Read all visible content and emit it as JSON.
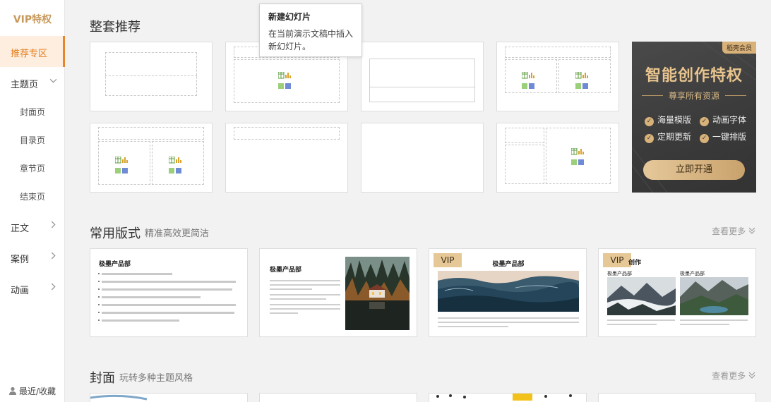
{
  "sidebar": {
    "vip_label": "VIP特权",
    "active_item": "推荐专区",
    "theme_item": "主题页",
    "theme_subitems": [
      "封面页",
      "目录页",
      "章节页",
      "结束页"
    ],
    "body_item": "正文",
    "case_item": "案例",
    "anim_item": "动画",
    "recent_label": "最近/收藏"
  },
  "sections": {
    "set_title": "整套推荐",
    "common_title": "常用版式",
    "common_sub": "精准高效更简洁",
    "cover_title": "封面",
    "cover_sub": "玩转多种主题风格",
    "more_label": "查看更多"
  },
  "tooltip": {
    "title": "新建幻灯片",
    "desc": "在当前演示文稿中插入新幻灯片。"
  },
  "promo": {
    "badge": "稻壳会员",
    "title": "智能创作特权",
    "subtitle": "尊享所有资源",
    "features": [
      "海量模版",
      "动画字体",
      "定期更新",
      "一键排版"
    ],
    "button": "立即开通"
  },
  "layout_cards": [
    {
      "heading": "极墨产品部"
    },
    {
      "heading": "极墨产品部"
    },
    {
      "vip": "VIP",
      "heading": "极墨产品部"
    },
    {
      "vip": "VIP",
      "heading": "创作",
      "col1": "极墨产品部",
      "col2": "极墨产品部"
    }
  ],
  "colors": {
    "accent": "#e9852a",
    "vip_gold": "#c8995b",
    "promo_gold": "#e8c48e"
  }
}
